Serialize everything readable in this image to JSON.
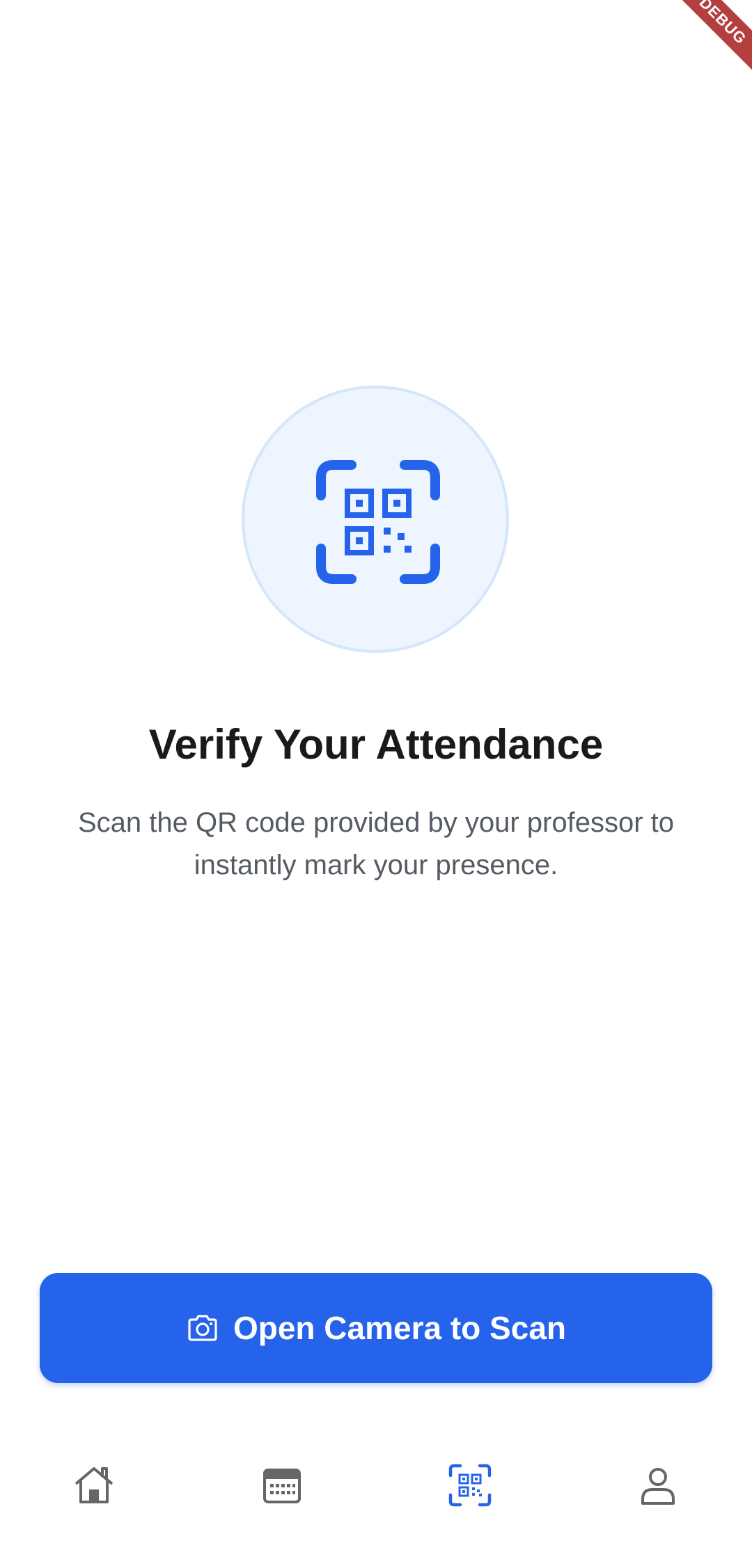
{
  "debug_banner": {
    "label": "DEBUG"
  },
  "hero": {
    "icon": "qr-scan-icon",
    "accent_color": "#2563eb",
    "circle_fill": "#eef5ff"
  },
  "title": "Verify Your Attendance",
  "subtitle": "Scan the QR code provided by your professor to instantly mark your presence.",
  "scan_button": {
    "label": "Open Camera to Scan",
    "icon": "camera-icon",
    "color": "#2563eb"
  },
  "bottom_nav": {
    "items": [
      {
        "icon": "home-icon",
        "active": false
      },
      {
        "icon": "calendar-icon",
        "active": false
      },
      {
        "icon": "qr-scan-icon",
        "active": true
      },
      {
        "icon": "profile-icon",
        "active": false
      }
    ],
    "active_color": "#2563eb",
    "inactive_color": "#666666"
  }
}
